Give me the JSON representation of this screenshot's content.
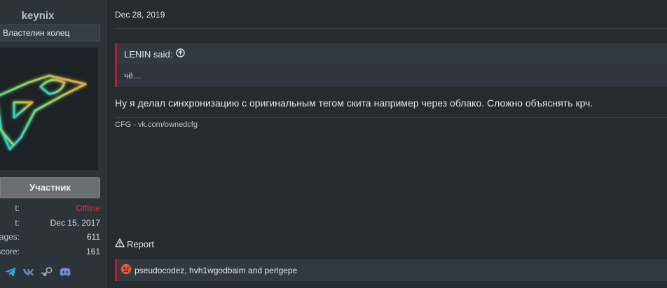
{
  "user": {
    "name": "keynix",
    "title": "Властелин колец",
    "role_badge": "Участник",
    "stats": [
      {
        "label": "t:",
        "value": "Offline"
      },
      {
        "label": "t:",
        "value": "Dec 15, 2017"
      },
      {
        "label": "ages:",
        "value": "611"
      },
      {
        "label": "on score:",
        "value": "161"
      }
    ],
    "social_icons": [
      "telegram-icon",
      "vk-icon",
      "steam-icon",
      "discord-icon"
    ]
  },
  "post": {
    "date": "Dec 28, 2019",
    "quote": {
      "author_said": "LENIN said:",
      "text": "чё…"
    },
    "message": "Ну я делал синхронизацию с оригинальным тегом скита например через облако. Сложно объяснять крч.",
    "signature": "CFG - vk.com/ownedcfg",
    "report_label": "Report",
    "reactions_text": "pseudocodez, hvh1wgodbaim and perlgepe"
  },
  "colors": {
    "accent": "#c01c2c",
    "offline": "#e0312e",
    "background": "#262b30"
  }
}
